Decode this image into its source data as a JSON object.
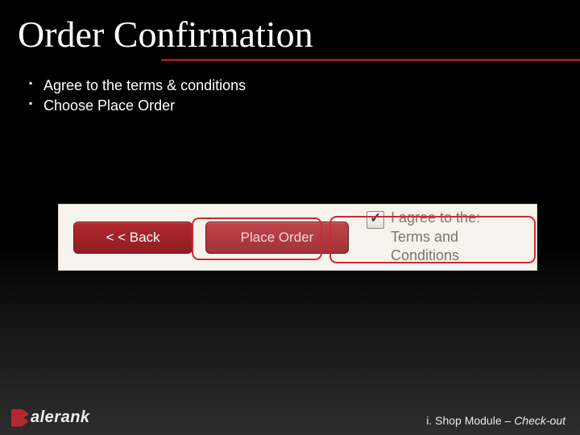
{
  "title": "Order Confirmation",
  "bullets": [
    "Agree to the terms & conditions",
    "Choose Place Order"
  ],
  "panel": {
    "back_label": "< < Back",
    "place_label": "Place Order",
    "agree_line1": "I agree to the:",
    "agree_line2": "Terms and Conditions"
  },
  "footer": {
    "brand": "alerank",
    "module_prefix": "i. Shop Module – ",
    "module_em": "Check-out"
  }
}
